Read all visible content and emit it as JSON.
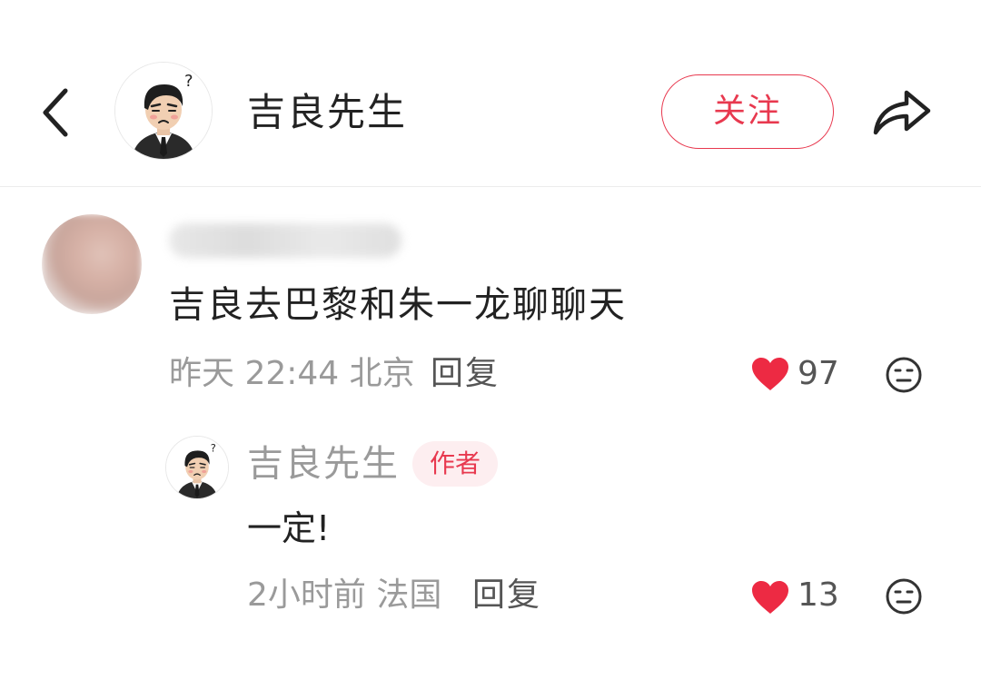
{
  "header": {
    "back_icon": "chevron-left-icon",
    "user_name": "吉良先生",
    "follow_label": "关注",
    "share_icon": "share-arrow-icon",
    "accent_color": "#e8394f"
  },
  "comment": {
    "text": "吉良去巴黎和朱一龙聊聊天",
    "time": "昨天 22:44",
    "location": "北京",
    "reply_label": "回复",
    "likes": "97"
  },
  "reply": {
    "user_name": "吉良先生",
    "badge": "作者",
    "text": "一定!",
    "time": "2小时前",
    "location": "法国",
    "reply_label": "回复",
    "likes": "13"
  }
}
